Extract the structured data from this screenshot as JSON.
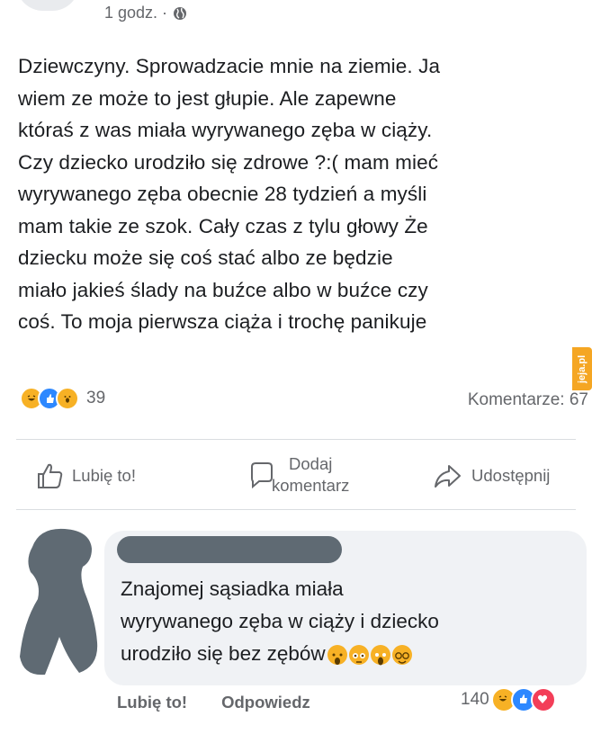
{
  "post": {
    "timestamp": "1 godz. ·",
    "privacy_icon": "globe-icon",
    "text_lines": [
      "Dziewczyny. Sprowadzacie mnie na ziemie. Ja",
      "wiem ze może to jest głupie. Ale zapewne",
      "któraś z was miała wyrywanego zęba w ciąży.",
      "Czy dziecko urodziło się zdrowe ?:( mam mieć",
      "wyrywanego zęba obecnie 28 tydzień a myśli",
      "mam takie ze szok. Cały czas z tylu głowy Że",
      "dziecku może się coś stać  albo ze będzie",
      "miało jakieś ślady na buźce albo w buźce czy",
      "coś. To moja pierwsza ciąża i trochę panikuje"
    ],
    "watermark": "jeja.pl",
    "reactions": {
      "types": [
        "haha-icon",
        "like-icon",
        "wow-icon"
      ],
      "count": "39"
    },
    "comments_count": "Komentarze: 67"
  },
  "actions": {
    "like": "Lubię to!",
    "comment_line1": "Dodaj",
    "comment_line2": "komentarz",
    "share": "Udostępnij"
  },
  "comment": {
    "text_lines": [
      "Znajomej sąsiadka miała",
      "wyrywanego zęba w ciąży i dziecko",
      "urodziło się bez zębów"
    ],
    "inline_emojis": [
      "shocked-face-icon",
      "flushed-face-icon",
      "screaming-face-icon",
      "nerd-face-icon"
    ],
    "like_label": "Lubię to!",
    "reply_label": "Odpowiedz",
    "reaction_count": "140",
    "reaction_types": [
      "haha-icon",
      "like-icon",
      "love-icon"
    ]
  },
  "colors": {
    "text": "#1c1e21",
    "secondary": "#65676b",
    "bubble": "#f0f2f5",
    "like_blue": "#2d88ff",
    "haha_yellow": "#f7b125",
    "love_red": "#f33e58"
  }
}
